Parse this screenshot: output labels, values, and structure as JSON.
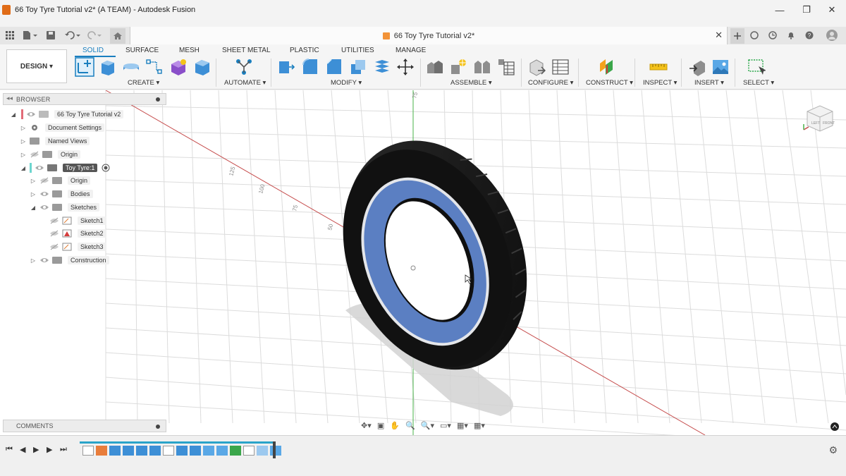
{
  "window": {
    "title": "66 Toy Tyre Tutorial v2* (A TEAM) - Autodesk Fusion",
    "minimize": "—",
    "maximize": "❐",
    "close": "✕"
  },
  "document_tab": {
    "title": "66 Toy Tyre Tutorial v2*",
    "close": "✕"
  },
  "ribbon": {
    "workspace_button": "DESIGN ▾",
    "tabs": [
      "SOLID",
      "SURFACE",
      "MESH",
      "SHEET METAL",
      "PLASTIC",
      "UTILITIES",
      "MANAGE"
    ],
    "active_tab": "SOLID",
    "groups": {
      "create": "CREATE ▾",
      "automate": "AUTOMATE ▾",
      "modify": "MODIFY ▾",
      "assemble": "ASSEMBLE ▾",
      "configure": "CONFIGURE ▾",
      "construct": "CONSTRUCT ▾",
      "inspect": "INSPECT ▾",
      "insert": "INSERT ▾",
      "select": "SELECT ▾"
    }
  },
  "browser": {
    "title": "BROWSER",
    "collapse": "◂◂",
    "items": [
      {
        "label": "66 Toy Tyre Tutorial v2",
        "expander": "◢"
      },
      {
        "label": "Document Settings",
        "expander": "▷"
      },
      {
        "label": "Named Views",
        "expander": "▷"
      },
      {
        "label": "Origin",
        "expander": "▷"
      },
      {
        "label": "Toy Tyre:1",
        "expander": "◢"
      },
      {
        "label": "Origin",
        "expander": "▷"
      },
      {
        "label": "Bodies",
        "expander": "▷"
      },
      {
        "label": "Sketches",
        "expander": "◢"
      },
      {
        "label": "Sketch1",
        "expander": ""
      },
      {
        "label": "Sketch2",
        "expander": ""
      },
      {
        "label": "Sketch3",
        "expander": ""
      },
      {
        "label": "Construction",
        "expander": "▷"
      }
    ]
  },
  "comments": {
    "title": "COMMENTS"
  },
  "viewport": {
    "axis_labels": [
      "75",
      "125",
      "100",
      "75",
      "50"
    ],
    "viewcube": {
      "left": "LEFT",
      "front": "FRONT"
    }
  },
  "navbar": {
    "items": [
      "✥▾",
      "▣",
      "✋",
      "🔍",
      "🔍▾",
      "▭▾",
      "▦▾",
      "▦▾"
    ]
  },
  "timeline": {
    "controls": [
      "⏮",
      "◀",
      "▶",
      "▶",
      "⏭"
    ],
    "settings": "⚙"
  },
  "colors": {
    "accent": "#1a7fbf",
    "tyre": "#1c1c1c",
    "rim": "#5b7fc2",
    "timeline_bar": "#2aa4c9"
  }
}
